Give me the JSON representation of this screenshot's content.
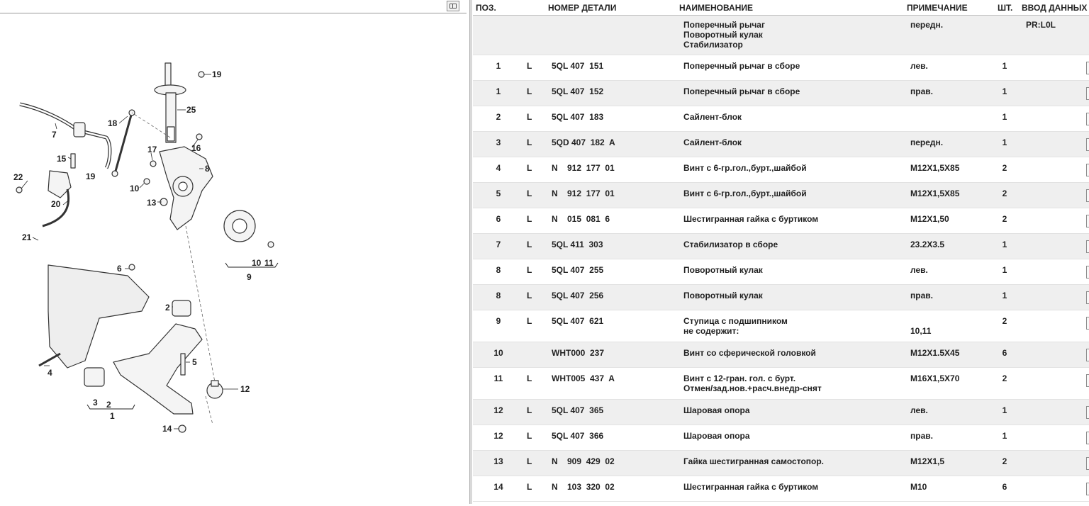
{
  "columns": {
    "pos": "ПОЗ.",
    "part_number": "НОМЕР ДЕТАЛИ",
    "name": "НАИМЕНОВАНИЕ",
    "note": "ПРИМЕЧАНИЕ",
    "qty": "ШТ.",
    "data": "ВВОД ДАННЫХ"
  },
  "header_row": {
    "names": [
      "Поперечный рычаг",
      "Поворотный кулак",
      "Стабилизатор"
    ],
    "note": "передн.",
    "data": "PR:L0L"
  },
  "rows": [
    {
      "pos": "1",
      "l": "L",
      "num": "5QL 407  151",
      "name": [
        "Поперечный рычаг в сборе"
      ],
      "note": [
        "лев."
      ],
      "qty": "1"
    },
    {
      "pos": "1",
      "l": "L",
      "num": "5QL 407  152",
      "name": [
        "Поперечный рычаг в сборе"
      ],
      "note": [
        "прав."
      ],
      "qty": "1"
    },
    {
      "pos": "2",
      "l": "L",
      "num": "5QL 407  183",
      "name": [
        "Сайлент-блок"
      ],
      "note": [
        ""
      ],
      "qty": "1"
    },
    {
      "pos": "3",
      "l": "L",
      "num": "5QD 407  182  A",
      "name": [
        "Сайлент-блок"
      ],
      "note": [
        "передн."
      ],
      "qty": "1"
    },
    {
      "pos": "4",
      "l": "L",
      "num": "N    912  177  01",
      "name": [
        "Винт с 6-гр.гол.,бурт.,шайбой"
      ],
      "note": [
        "M12X1,5X85"
      ],
      "qty": "2"
    },
    {
      "pos": "5",
      "l": "L",
      "num": "N    912  177  01",
      "name": [
        "Винт с 6-гр.гол.,бурт.,шайбой"
      ],
      "note": [
        "M12X1,5X85"
      ],
      "qty": "2"
    },
    {
      "pos": "6",
      "l": "L",
      "num": "N    015  081  6",
      "name": [
        "Шестигранная гайка с буртиком"
      ],
      "note": [
        "M12X1,50"
      ],
      "qty": "2"
    },
    {
      "pos": "7",
      "l": "L",
      "num": "5QL 411  303",
      "name": [
        "Стабилизатор в сборе"
      ],
      "note": [
        "23.2X3.5"
      ],
      "qty": "1"
    },
    {
      "pos": "8",
      "l": "L",
      "num": "5QL 407  255",
      "name": [
        "Поворотный кулак"
      ],
      "note": [
        "лев."
      ],
      "qty": "1"
    },
    {
      "pos": "8",
      "l": "L",
      "num": "5QL 407  256",
      "name": [
        "Поворотный кулак"
      ],
      "note": [
        "прав."
      ],
      "qty": "1"
    },
    {
      "pos": "9",
      "l": "L",
      "num": "5QL 407  621",
      "name": [
        "Ступица с подшипником",
        "не содержит:"
      ],
      "note": [
        "",
        "10,11"
      ],
      "qty": "2"
    },
    {
      "pos": "10",
      "l": "",
      "num": "WHT000  237",
      "name": [
        "Винт со сферической головкой"
      ],
      "note": [
        "M12X1.5X45"
      ],
      "qty": "6"
    },
    {
      "pos": "11",
      "l": "L",
      "num": "WHT005  437  A",
      "name": [
        "Винт с 12-гран. гол. с бурт.",
        "Отмен/зад.нов.+расч.внедр-снят"
      ],
      "note": [
        "M16X1,5X70"
      ],
      "qty": "2"
    },
    {
      "pos": "12",
      "l": "L",
      "num": "5QL 407  365",
      "name": [
        "Шаровая опора"
      ],
      "note": [
        "лев."
      ],
      "qty": "1"
    },
    {
      "pos": "12",
      "l": "L",
      "num": "5QL 407  366",
      "name": [
        "Шаровая опора"
      ],
      "note": [
        "прав."
      ],
      "qty": "1"
    },
    {
      "pos": "13",
      "l": "L",
      "num": "N    909  429  02",
      "name": [
        "Гайка шестигранная самостопор."
      ],
      "note": [
        "M12X1,5"
      ],
      "qty": "2"
    },
    {
      "pos": "14",
      "l": "L",
      "num": "N    103  320  02",
      "name": [
        "Шестигранная гайка с буртиком"
      ],
      "note": [
        "M10"
      ],
      "qty": "6"
    }
  ],
  "callouts": [
    "19",
    "25",
    "7",
    "18",
    "16",
    "17",
    "15",
    "8",
    "19",
    "22",
    "10",
    "13",
    "20",
    "21",
    "6",
    "10",
    "11",
    "9",
    "2",
    "5",
    "4",
    "12",
    "3",
    "2",
    "1",
    "14"
  ],
  "icons": {
    "view_toggle": "layout-toggle-icon"
  }
}
